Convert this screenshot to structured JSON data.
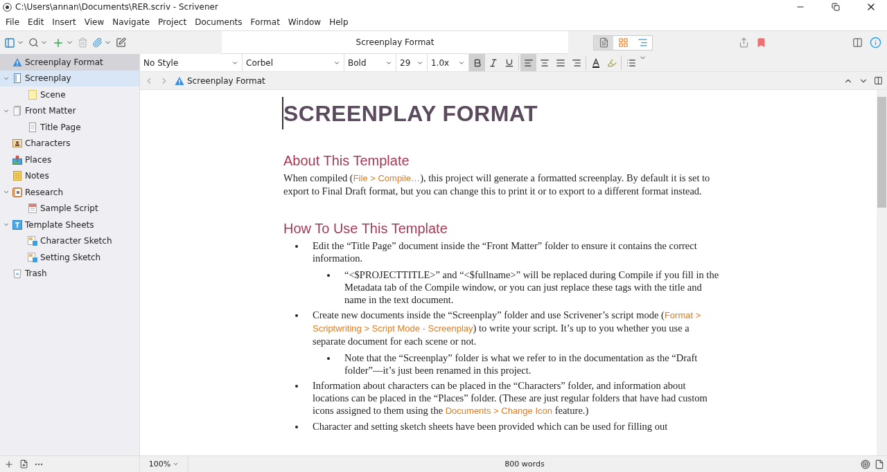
{
  "window": {
    "title": "C:\\Users\\annan\\Documents\\RER.scriv - Scrivener"
  },
  "menu": [
    "File",
    "Edit",
    "Insert",
    "View",
    "Navigate",
    "Project",
    "Documents",
    "Format",
    "Window",
    "Help"
  ],
  "toolbar": {
    "document_title": "Screenplay Format",
    "view_modes": [
      {
        "kind": "document",
        "selected": true
      },
      {
        "kind": "corkboard",
        "selected": false
      },
      {
        "kind": "outline",
        "selected": false
      }
    ]
  },
  "binder": {
    "items": [
      {
        "label": "Screenplay Format",
        "current": true,
        "selected": false
      },
      {
        "label": "Screenplay",
        "current": false,
        "selected": true,
        "expanded": true,
        "children": [
          {
            "label": "Scene",
            "current": false,
            "selected": false
          }
        ]
      },
      {
        "label": "Front Matter",
        "current": false,
        "selected": false,
        "expanded": true,
        "children": [
          {
            "label": "Title Page",
            "current": false,
            "selected": false
          }
        ]
      },
      {
        "label": "Characters",
        "current": false,
        "selected": false
      },
      {
        "label": "Places",
        "current": false,
        "selected": false
      },
      {
        "label": "Notes",
        "current": false,
        "selected": false
      },
      {
        "label": "Research",
        "current": false,
        "selected": false,
        "expanded": true,
        "children": [
          {
            "label": "Sample Script",
            "current": false,
            "selected": false
          }
        ]
      },
      {
        "label": "Template Sheets",
        "current": false,
        "selected": false,
        "expanded": true,
        "children": [
          {
            "label": "Character Sketch",
            "current": false,
            "selected": false
          },
          {
            "label": "Setting Sketch",
            "current": false,
            "selected": false
          }
        ]
      },
      {
        "label": "Trash",
        "current": false,
        "selected": false
      }
    ]
  },
  "format_bar": {
    "style": "No Style",
    "font": "Corbel",
    "weight": "Bold",
    "size": "29",
    "spacing": "1.0x",
    "bold": true,
    "italic": false,
    "underline": false,
    "alignments": [
      {
        "kind": "left",
        "selected": true
      },
      {
        "kind": "center",
        "selected": false
      },
      {
        "kind": "justify",
        "selected": false
      },
      {
        "kind": "right",
        "selected": false
      }
    ]
  },
  "header": {
    "title": "Screenplay Format"
  },
  "document": [
    {
      "kind": "title",
      "text": "SCREENPLAY FORMAT"
    },
    {
      "kind": "heading",
      "text": "About This Template"
    },
    {
      "kind": "paragraph",
      "text": "When compiled (**File > Compile…**), this project will generate a formatted screenplay. By default it is set to export to Final Draft format, but you can change this to print it or to export to a different format instead."
    },
    {
      "kind": "heading",
      "text": "How To Use This Template"
    },
    {
      "kind": "bullet",
      "text": "Edit the “Title Page” document inside the “Front Matter” folder to ensure it contains the correct information.",
      "children": [
        {
          "kind": "bullet",
          "text": "“<$PROJECTTITLE>” and “<$fullname>” will be replaced during Compile if you fill in the Metadata tab of the Compile window, or you can just replace these tags with the title and name in the text document."
        }
      ]
    },
    {
      "kind": "bullet",
      "text": "Create new documents inside the “Screenplay” folder and use Scrivener’s script mode (**Format > Scriptwriting > Script Mode - Screenplay**) to write your script. It’s up to you whether you use a separate document for each scene or not.",
      "children": [
        {
          "kind": "bullet",
          "text": "Note that the “Screenplay” folder is what we refer to in the documentation as the “Draft folder”—it’s just been renamed in this project."
        }
      ]
    },
    {
      "kind": "bullet",
      "text": "Information about characters can be placed in the “Characters” folder, and information about locations can be placed in the “Places” folder. (These are just regular folders that have had custom icons assigned to them using the **Documents > Change Icon** feature.)"
    },
    {
      "kind": "bullet",
      "text": "Character and setting sketch sheets have been provided which can be used for filling out"
    }
  ],
  "footer": {
    "zoom": "100%",
    "word_count": "800 words"
  }
}
